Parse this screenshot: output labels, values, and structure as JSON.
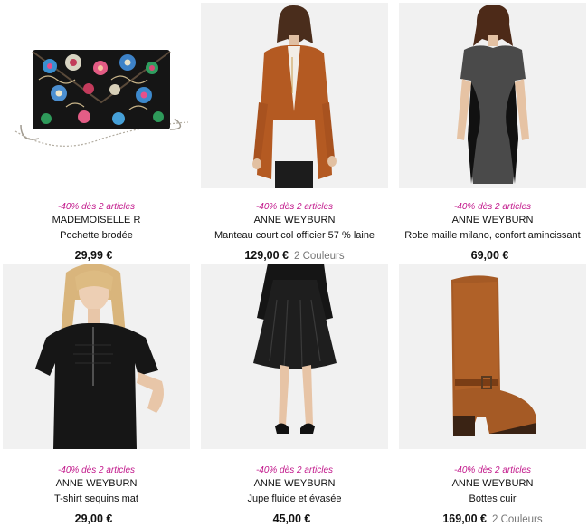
{
  "promo_color": "#c2188b",
  "products": [
    {
      "image": "pochette-embroidered-clutch-image",
      "promo": "-40% dès 2 articles",
      "brand": "MADEMOISELLE R",
      "title": "Pochette brodée",
      "price": "29,99 €",
      "colors": ""
    },
    {
      "image": "rust-coat-model-image",
      "promo": "-40% dès 2 articles",
      "brand": "ANNE WEYBURN",
      "title": "Manteau court col officier 57 % laine",
      "price": "129,00 €",
      "colors": "2 Couleurs"
    },
    {
      "image": "grey-black-dress-model-image",
      "promo": "-40% dès 2 articles",
      "brand": "ANNE WEYBURN",
      "title": "Robe maille milano, confort amincissant",
      "price": "69,00 €",
      "colors": ""
    },
    {
      "image": "black-sequin-tshirt-model-image",
      "promo": "-40% dès 2 articles",
      "brand": "ANNE WEYBURN",
      "title": "T-shirt sequins mat",
      "price": "29,00 €",
      "colors": ""
    },
    {
      "image": "black-flared-skirt-model-image",
      "promo": "-40% dès 2 articles",
      "brand": "ANNE WEYBURN",
      "title": "Jupe fluide et évasée",
      "price": "45,00 €",
      "colors": ""
    },
    {
      "image": "brown-leather-boot-image",
      "promo": "-40% dès 2 articles",
      "brand": "ANNE WEYBURN",
      "title": "Bottes cuir",
      "price": "169,00 €",
      "colors": "2 Couleurs"
    }
  ]
}
